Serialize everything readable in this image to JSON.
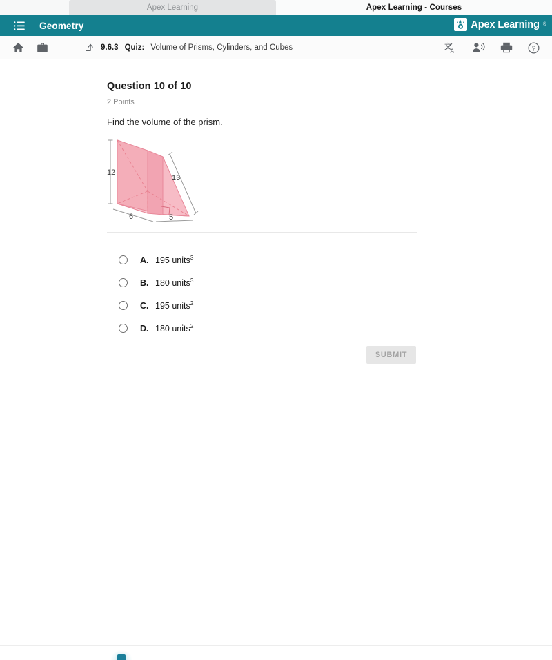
{
  "browser": {
    "tabs": [
      {
        "label": "Apex Learning",
        "active": false,
        "has_close": true
      },
      {
        "label": "Apex Learning - Courses",
        "active": true,
        "has_close": false
      }
    ]
  },
  "appbar": {
    "menu_icon": "hamburger-menu-icon",
    "course_name": "Geometry",
    "brand_name": "Apex Learning",
    "brand_trademark": "®",
    "background_color": "#14808f",
    "text_color": "#ffffff"
  },
  "toolbar": {
    "left_icons": [
      {
        "name": "home-icon"
      },
      {
        "name": "briefcase-icon"
      }
    ],
    "breadcrumb": {
      "up_icon": "arrow-up-level-icon",
      "number": "9.6.3",
      "kind": "Quiz:",
      "title": "Volume of Prisms, Cylinders, and Cubes"
    },
    "right_icons": [
      {
        "name": "translate-icon"
      },
      {
        "name": "text-to-speech-icon"
      },
      {
        "name": "print-icon"
      },
      {
        "name": "help-icon"
      }
    ]
  },
  "question": {
    "heading": "Question 10 of 10",
    "points": "2 Points",
    "prompt": "Find the volume of the prism."
  },
  "figure": {
    "name": "triangular-prism-diagram",
    "fill_color": "#f6b8c0",
    "stroke_color": "#e8808f",
    "labels": {
      "height": "12",
      "hypotenuse": "13",
      "depth": "6",
      "base": "5"
    },
    "right_angle_marker": true
  },
  "choices": [
    {
      "letter": "A.",
      "value": "195 units",
      "exponent": "3",
      "selected": false
    },
    {
      "letter": "B.",
      "value": "180 units",
      "exponent": "3",
      "selected": false
    },
    {
      "letter": "C.",
      "value": "195 units",
      "exponent": "2",
      "selected": false
    },
    {
      "letter": "D.",
      "value": "180 units",
      "exponent": "2",
      "selected": false
    }
  ],
  "submit": {
    "label": "SUBMIT",
    "enabled": false
  }
}
